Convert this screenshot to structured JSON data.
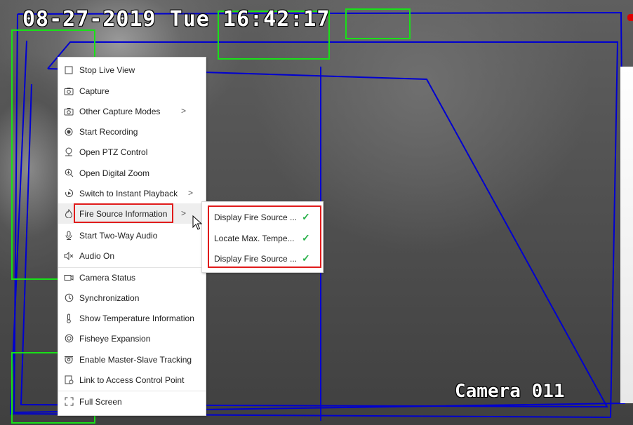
{
  "osd": {
    "datetime": "08-27-2019 Tue 16:42:17",
    "camera": "Camera 011"
  },
  "colors": {
    "rule_line": "#0000d0",
    "detect_box": "#18e018",
    "highlight_border": "#e01b1b",
    "check": "#2bb24c"
  },
  "context_menu": {
    "items": [
      {
        "id": "stop-live-view",
        "label": "Stop Live View",
        "icon": "square-icon",
        "submenu": false
      },
      {
        "id": "capture",
        "label": "Capture",
        "icon": "camera-icon",
        "submenu": false
      },
      {
        "id": "other-capture-modes",
        "label": "Other Capture Modes",
        "icon": "camera-icon",
        "submenu": true
      },
      {
        "id": "start-recording",
        "label": "Start Recording",
        "icon": "record-icon",
        "submenu": false
      },
      {
        "id": "open-ptz-control",
        "label": "Open PTZ Control",
        "icon": "ptz-icon",
        "submenu": false
      },
      {
        "id": "open-digital-zoom",
        "label": "Open Digital Zoom",
        "icon": "zoom-icon",
        "submenu": false
      },
      {
        "id": "switch-to-instant-playback",
        "label": "Switch to Instant Playback",
        "icon": "playback-icon",
        "submenu": true
      },
      {
        "id": "fire-source-information",
        "label": "Fire Source Information",
        "icon": "fire-icon",
        "submenu": true,
        "highlighted": true
      },
      {
        "id": "start-two-way-audio",
        "label": "Start Two-Way Audio",
        "icon": "microphone-icon",
        "submenu": false
      },
      {
        "id": "audio-on",
        "label": "Audio On",
        "icon": "speaker-muted-icon",
        "submenu": false
      },
      {
        "id": "camera-status",
        "label": "Camera Status",
        "icon": "camera-status-icon",
        "submenu": false
      },
      {
        "id": "synchronization",
        "label": "Synchronization",
        "icon": "clock-icon",
        "submenu": false
      },
      {
        "id": "show-temperature-information",
        "label": "Show Temperature Information",
        "icon": "thermometer-icon",
        "submenu": false
      },
      {
        "id": "fisheye-expansion",
        "label": "Fisheye Expansion",
        "icon": "fisheye-icon",
        "submenu": false
      },
      {
        "id": "enable-master-slave-tracking",
        "label": "Enable Master-Slave Tracking",
        "icon": "tracking-icon",
        "submenu": false
      },
      {
        "id": "link-to-access-control-point",
        "label": "Link to Access Control Point",
        "icon": "link-icon",
        "submenu": false
      },
      {
        "id": "full-screen",
        "label": "Full Screen",
        "icon": "fullscreen-icon",
        "submenu": false
      }
    ]
  },
  "fire_submenu": {
    "items": [
      {
        "label": "Display Fire Source ...",
        "checked": true
      },
      {
        "label": "Locate Max. Tempe...",
        "checked": true
      },
      {
        "label": "Display Fire Source ...",
        "checked": true
      }
    ]
  }
}
